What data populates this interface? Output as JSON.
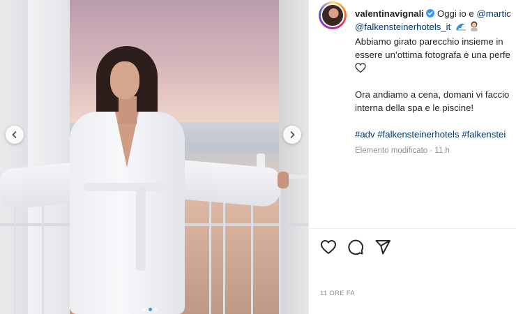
{
  "post": {
    "username": "valentinavignali",
    "caption": {
      "line1_text": "Oggi io e",
      "line1_mention": "@martic",
      "line2_mention": "@falkensteinerhotels_it",
      "line3": "Abbiamo girato parecchio insieme in",
      "line4": "essere un’ottima fotografa è una perfe",
      "line6": "Ora andiamo a cena, domani vi faccio",
      "line7": "interna della spa e le piscine!",
      "hashtags": "#adv #falkensteinerhotels #falkenstei"
    },
    "edited_meta": "Elemento modificato · 11 h",
    "timestamp": "11 ORE FA"
  },
  "icons": {
    "verified": "verified-badge-icon",
    "like": "heart-icon",
    "comment": "comment-bubble-icon",
    "share": "paper-plane-icon",
    "prev": "chevron-left-icon",
    "next": "chevron-right-icon"
  },
  "colors": {
    "link": "#00376b",
    "verified": "#3897f0",
    "meta": "#8e8e8e",
    "text": "#262626"
  },
  "carousel": {
    "slide_count": 3,
    "active_slide": 2
  }
}
